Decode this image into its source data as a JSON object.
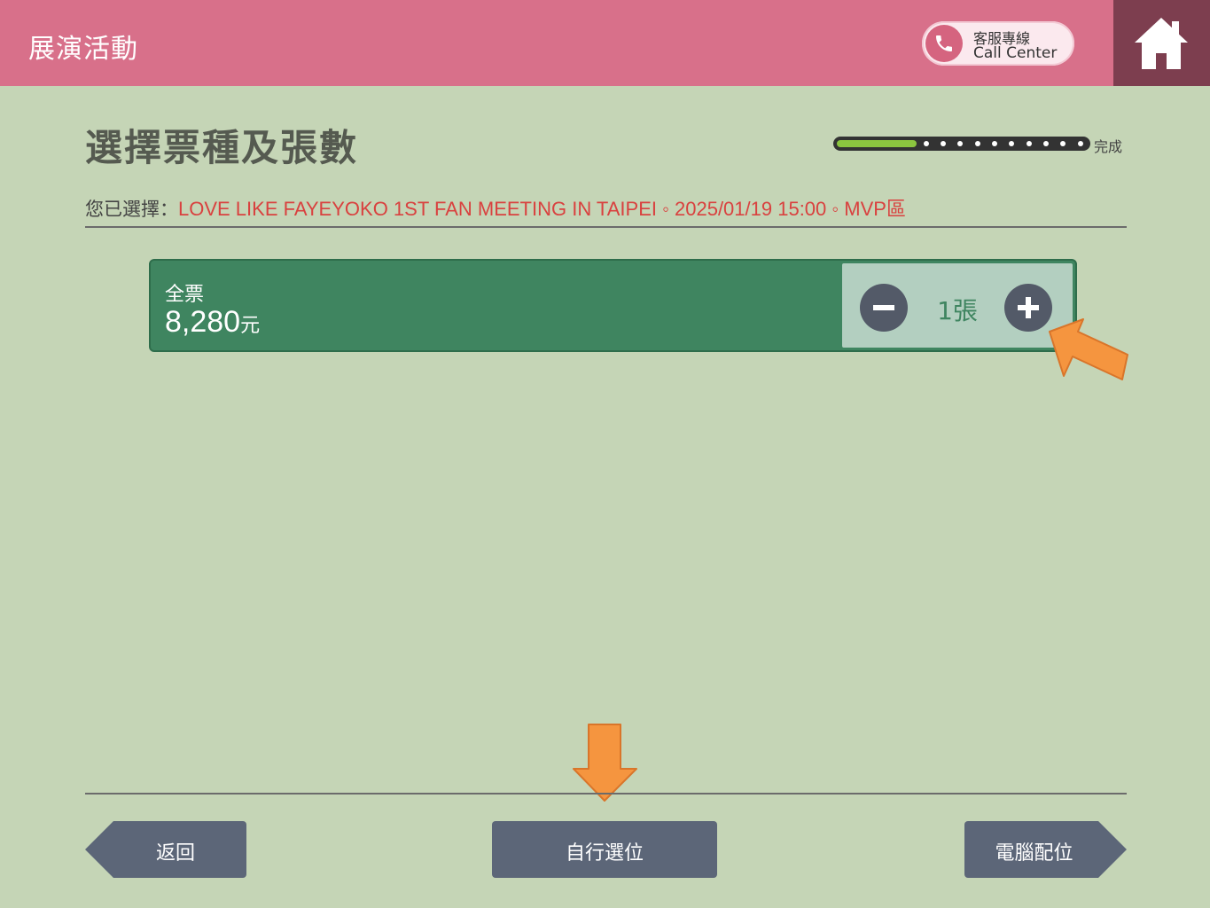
{
  "header": {
    "title": "展演活動",
    "call_center": {
      "line1": "客服專線",
      "line2": "Call Center",
      "icon": "phone-icon"
    },
    "home_icon": "home-icon"
  },
  "page": {
    "title": "選擇票種及張數",
    "progress": {
      "fraction": 0.32,
      "label": "完成"
    }
  },
  "selection": {
    "label": "您已選擇：",
    "value": "LOVE LIKE FAYEYOKO 1ST FAN MEETING IN TAIPEI ◦ 2025/01/19 15:00 ◦ MVP區"
  },
  "ticket": {
    "type": "全票",
    "price": "8,280",
    "unit": "元",
    "quantity": "1張"
  },
  "buttons": {
    "back": "返回",
    "self_select": "自行選位",
    "auto_select": "電腦配位"
  },
  "colors": {
    "header": "#d8708a",
    "home": "#7d3e4f",
    "background": "#c5d5b6",
    "ticket": "#3f8560",
    "button": "#5c6678",
    "accent_text": "#d9413f",
    "arrow": "#f5953f"
  }
}
